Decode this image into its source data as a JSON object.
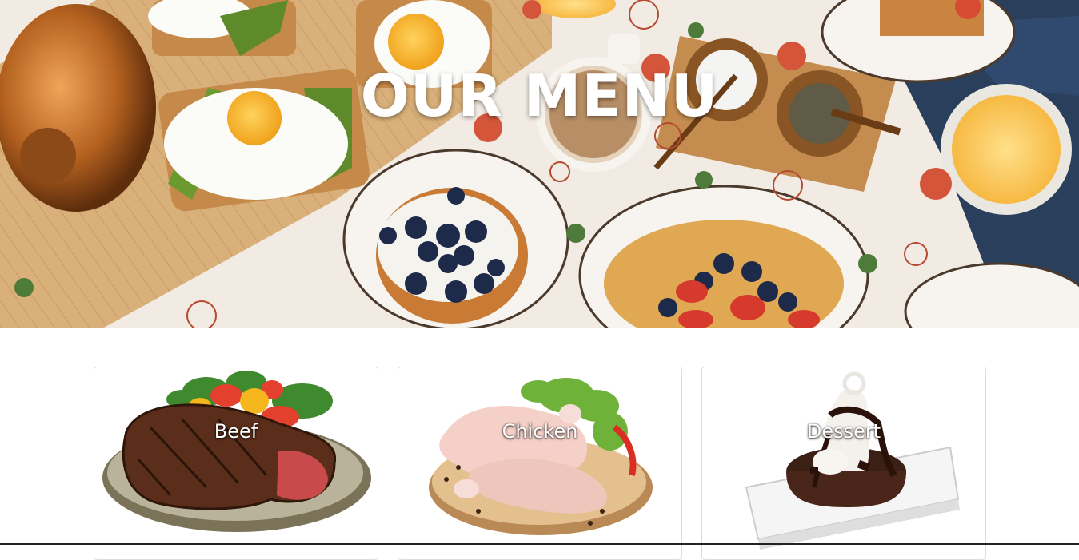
{
  "hero": {
    "title": "OUR MENU"
  },
  "categories": [
    {
      "label": "Beef"
    },
    {
      "label": "Chicken"
    },
    {
      "label": "Dessert"
    }
  ],
  "colors": {
    "title_text": "#ffffff",
    "card_border": "#dcdcdc",
    "page_background": "#ffffff"
  }
}
